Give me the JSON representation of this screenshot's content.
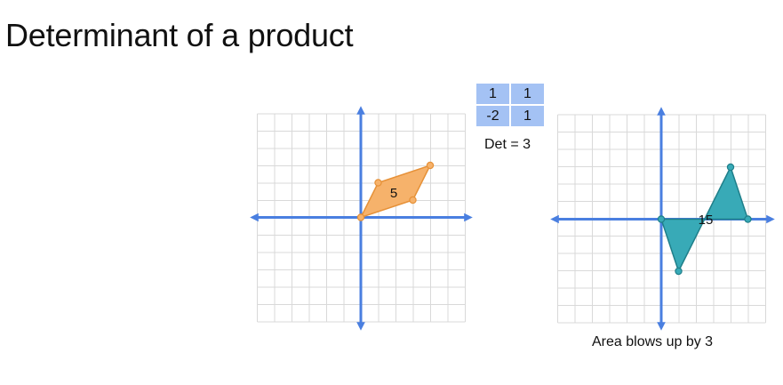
{
  "title": "Determinant of a product",
  "matrix": {
    "rows": [
      [
        "1",
        "1"
      ],
      [
        "-2",
        "1"
      ]
    ],
    "cell_color": "#a4c2f4"
  },
  "det_label": "Det = 3",
  "left_graph": {
    "area_label": "5",
    "fill_color": "#f6b26b",
    "vertices": [
      [
        0,
        0
      ],
      [
        1,
        2
      ],
      [
        3,
        1
      ],
      [
        4,
        3
      ]
    ]
  },
  "right_graph": {
    "area_label": "15",
    "fill_color": "#38aab7",
    "vertices": [
      [
        0,
        0
      ],
      [
        1,
        -3
      ],
      [
        5,
        0
      ],
      [
        4,
        3
      ]
    ]
  },
  "caption": "Area blows up by 3",
  "colors": {
    "axis": "#4a7fe0",
    "grid": "#d9d9d9"
  }
}
